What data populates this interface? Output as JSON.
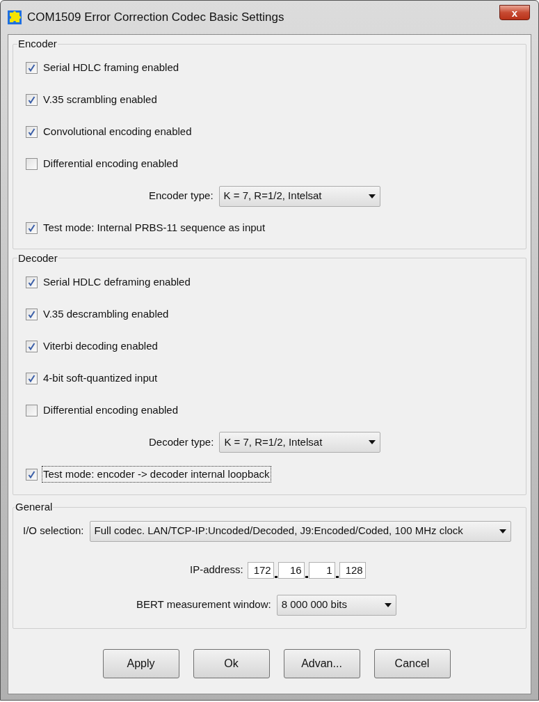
{
  "window": {
    "title": "COM1509 Error Correction Codec Basic Settings",
    "close": "x"
  },
  "groups": [
    {
      "title": "Encoder",
      "items": [
        {
          "kind": "checkbox",
          "label": "Serial HDLC framing enabled",
          "checked": true,
          "focused": false
        },
        {
          "kind": "checkbox",
          "label": "V.35 scrambling enabled",
          "checked": true,
          "focused": false
        },
        {
          "kind": "checkbox",
          "label": "Convolutional encoding enabled",
          "checked": true,
          "focused": false
        },
        {
          "kind": "checkbox",
          "label": "Differential encoding enabled",
          "checked": false,
          "focused": false
        },
        {
          "kind": "select",
          "label": "Encoder type:",
          "value": "K = 7, R=1/2, Intelsat"
        },
        {
          "kind": "checkbox",
          "label": "Test mode: Internal PRBS-11 sequence as input",
          "checked": true,
          "focused": false
        }
      ]
    },
    {
      "title": "Decoder",
      "items": [
        {
          "kind": "checkbox",
          "label": "Serial HDLC deframing enabled",
          "checked": true,
          "focused": false
        },
        {
          "kind": "checkbox",
          "label": "V.35 descrambling enabled",
          "checked": true,
          "focused": false
        },
        {
          "kind": "checkbox",
          "label": "Viterbi decoding enabled",
          "checked": true,
          "focused": false
        },
        {
          "kind": "checkbox",
          "label": "4-bit soft-quantized input",
          "checked": true,
          "focused": false
        },
        {
          "kind": "checkbox",
          "label": "Differential encoding enabled",
          "checked": false,
          "focused": false
        },
        {
          "kind": "select",
          "label": "Decoder type:",
          "value": "K = 7, R=1/2, Intelsat"
        },
        {
          "kind": "checkbox",
          "label": "Test mode: encoder -> decoder internal loopback",
          "checked": true,
          "focused": true
        }
      ]
    }
  ],
  "general": {
    "title": "General",
    "io_selection": {
      "label": "I/O selection:",
      "value": "Full codec. LAN/TCP-IP:Uncoded/Decoded, J9:Encoded/Coded, 100 MHz clock"
    },
    "ip_address": {
      "label": "IP-address:",
      "octets": [
        "172",
        "16",
        "1",
        "128"
      ]
    },
    "bert_window": {
      "label": "BERT measurement window:",
      "value": "8 000 000 bits"
    }
  },
  "buttons": [
    "Apply",
    "Ok",
    "Advan...",
    "Cancel"
  ]
}
